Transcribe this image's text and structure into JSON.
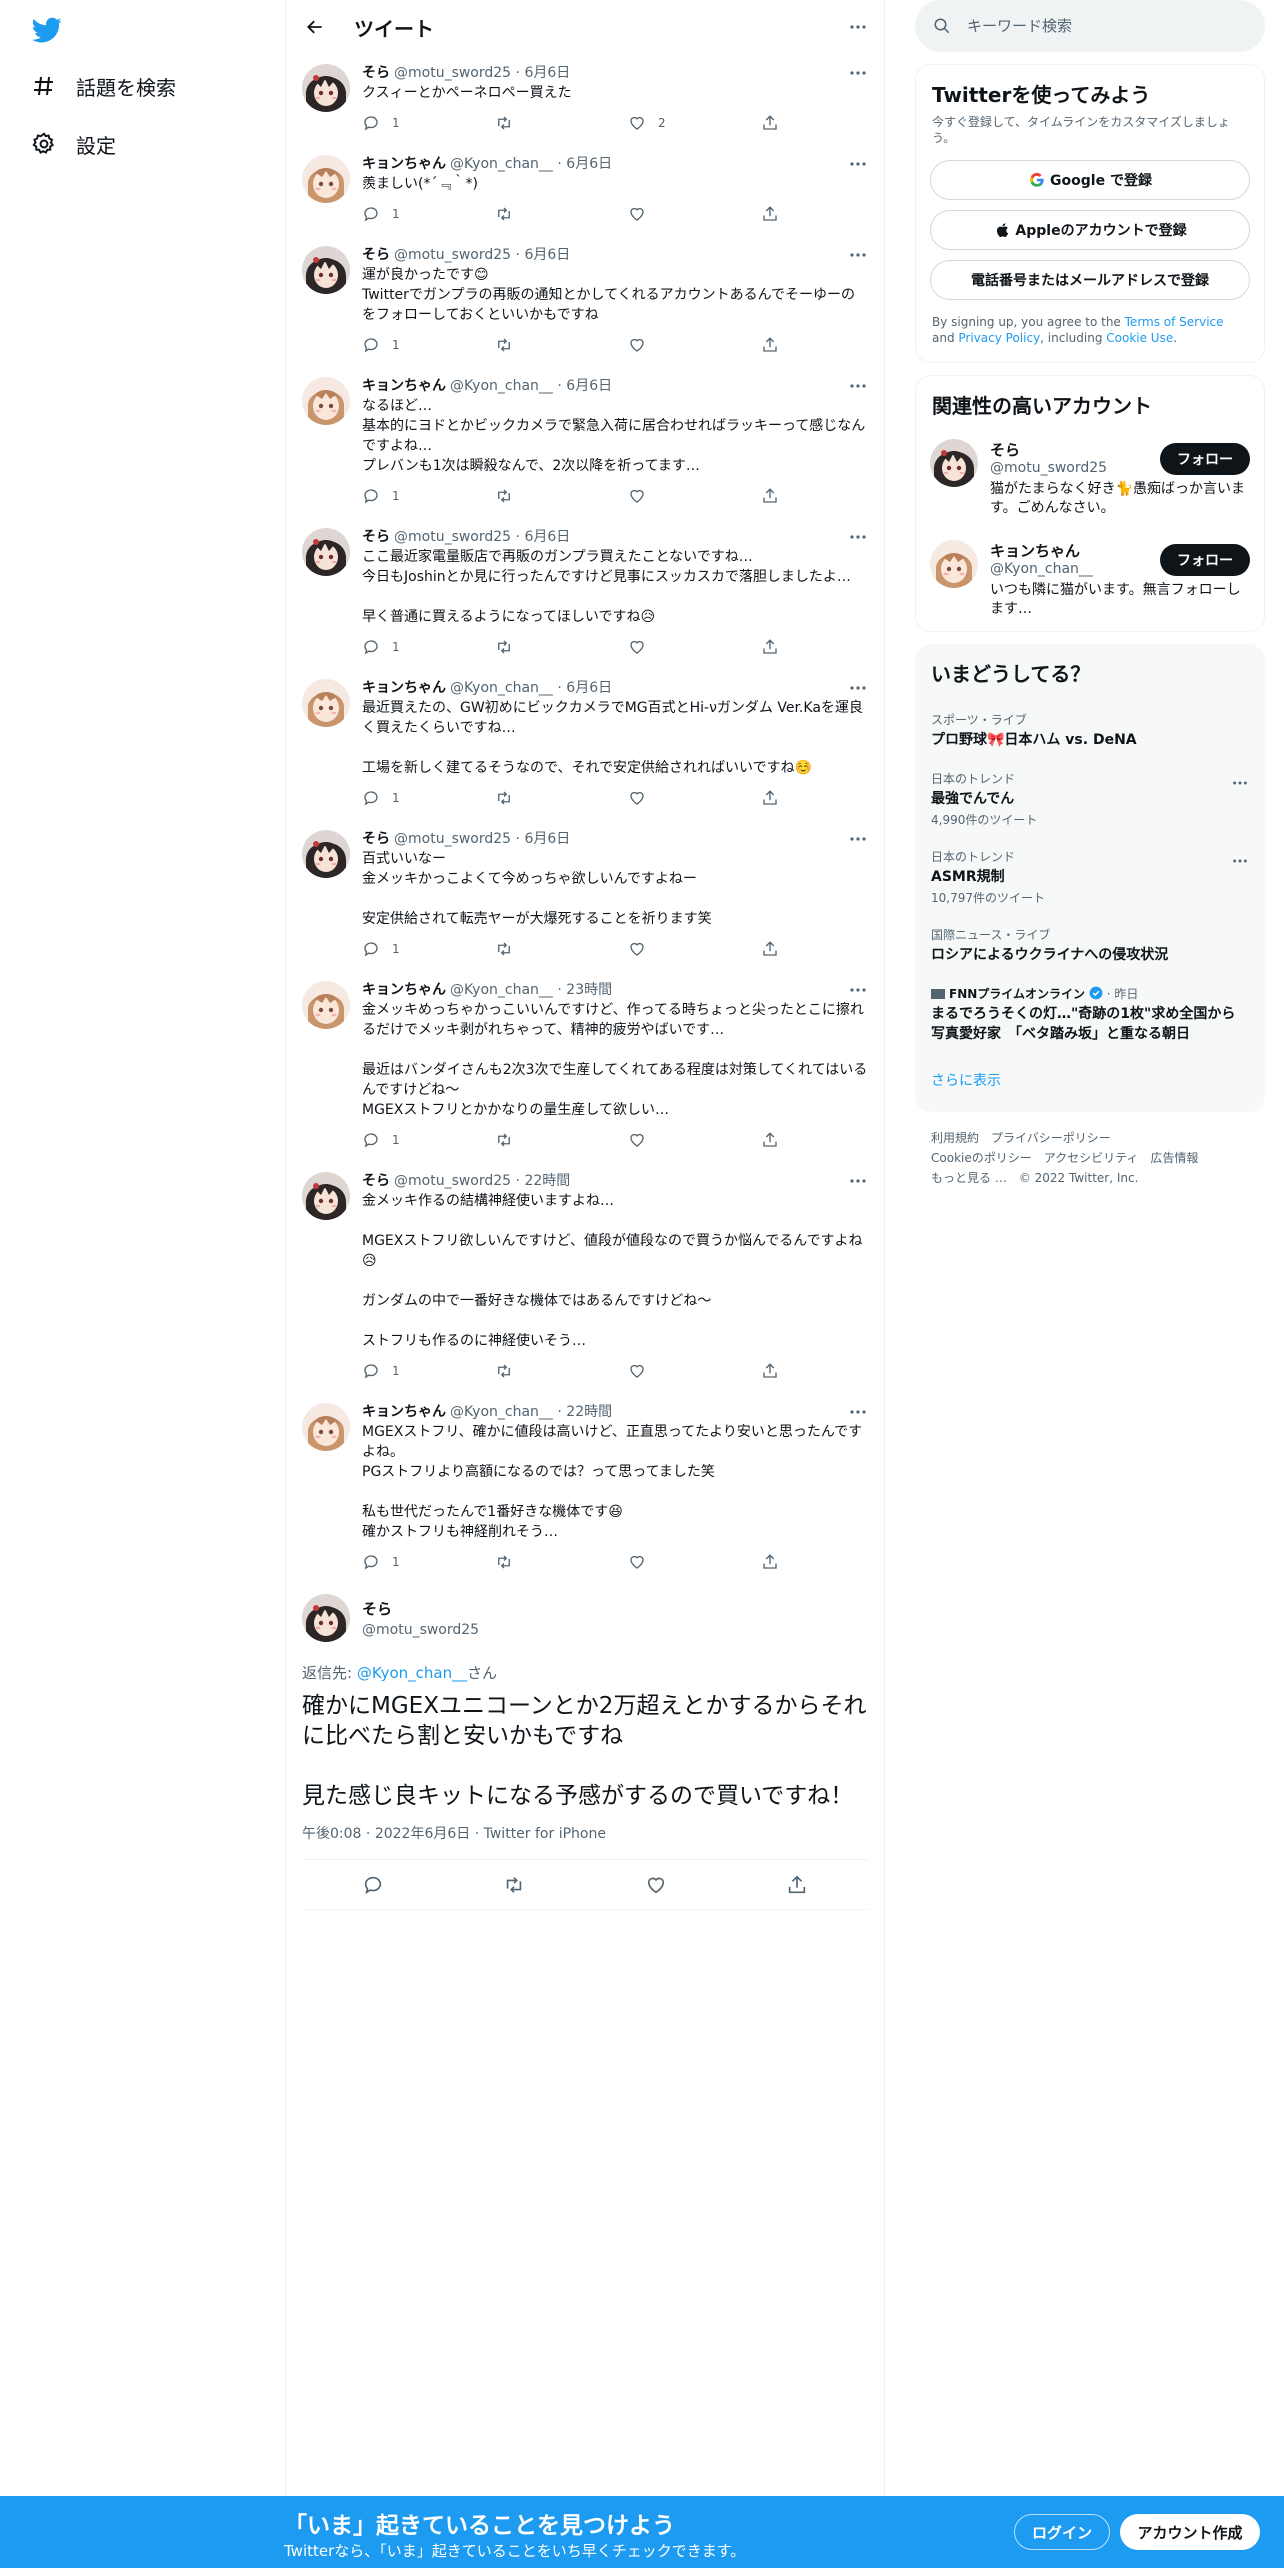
{
  "nav": {
    "explore_label": "話題を検索",
    "settings_label": "設定",
    "brand_color": "#1d9bf0"
  },
  "header": {
    "title": "ツイート"
  },
  "thread": [
    {
      "name": "そら",
      "handle": "@motu_sword25",
      "time": "6月6日",
      "text": "クスィーとかペーネロペー買えた",
      "replies": "1",
      "retweets": "",
      "likes": "2",
      "avatar": "sora"
    },
    {
      "name": "キョンちゃん",
      "handle": "@Kyon_chan__",
      "time": "6月6日",
      "text": "羨ましい(*´﹃｀*)",
      "replies": "1",
      "retweets": "",
      "likes": "",
      "avatar": "kyon"
    },
    {
      "name": "そら",
      "handle": "@motu_sword25",
      "time": "6月6日",
      "text": "運が良かったです😊\nTwitterでガンプラの再販の通知とかしてくれるアカウントあるんでそーゆーのをフォローしておくといいかもですね",
      "replies": "1",
      "retweets": "",
      "likes": "",
      "avatar": "sora"
    },
    {
      "name": "キョンちゃん",
      "handle": "@Kyon_chan__",
      "time": "6月6日",
      "text": "なるほど…\n基本的にヨドとかビックカメラで緊急入荷に居合わせればラッキーって感じなんですよね…\nプレバンも1次は瞬殺なんで、2次以降を祈ってます…",
      "replies": "1",
      "retweets": "",
      "likes": "",
      "avatar": "kyon"
    },
    {
      "name": "そら",
      "handle": "@motu_sword25",
      "time": "6月6日",
      "text": "ここ最近家電量販店で再販のガンプラ買えたことないですね…\n今日もJoshinとか見に行ったんですけど見事にスッカスカで落胆しましたよ…\n\n早く普通に買えるようになってほしいですね😥",
      "replies": "1",
      "retweets": "",
      "likes": "",
      "avatar": "sora"
    },
    {
      "name": "キョンちゃん",
      "handle": "@Kyon_chan__",
      "time": "6月6日",
      "text": "最近買えたの、GW初めにビックカメラでMG百式とHi-νガンダム Ver.Kaを運良く買えたくらいですね…\n\n工場を新しく建てるそうなので、それで安定供給されればいいですね☺️",
      "replies": "1",
      "retweets": "",
      "likes": "",
      "avatar": "kyon"
    },
    {
      "name": "そら",
      "handle": "@motu_sword25",
      "time": "6月6日",
      "text": "百式いいなー\n金メッキかっこよくて今めっちゃ欲しいんですよねー\n\n安定供給されて転売ヤーが大爆死することを祈ります笑",
      "replies": "1",
      "retweets": "",
      "likes": "",
      "avatar": "sora"
    },
    {
      "name": "キョンちゃん",
      "handle": "@Kyon_chan__",
      "time": "23時間",
      "text": "金メッキめっちゃかっこいいんですけど、作ってる時ちょっと尖ったとこに擦れるだけでメッキ剥がれちゃって、精神的疲労やばいです…\n\n最近はバンダイさんも2次3次で生産してくれてある程度は対策してくれてはいるんですけどね〜\nMGEXストフリとかかなりの量生産して欲しい…",
      "replies": "1",
      "retweets": "",
      "likes": "",
      "avatar": "kyon"
    },
    {
      "name": "そら",
      "handle": "@motu_sword25",
      "time": "22時間",
      "text": "金メッキ作るの結構神経使いますよね…\n\nMGEXストフリ欲しいんですけど、値段が値段なので買うか悩んでるんですよね😥\n\nガンダムの中で一番好きな機体ではあるんですけどね〜\n\nストフリも作るのに神経使いそう…",
      "replies": "1",
      "retweets": "",
      "likes": "",
      "avatar": "sora"
    },
    {
      "name": "キョンちゃん",
      "handle": "@Kyon_chan__",
      "time": "22時間",
      "text": "MGEXストフリ、確かに値段は高いけど、正直思ってたより安いと思ったんですよね。\nPGストフリより高額になるのでは？って思ってました笑\n\n私も世代だったんで1番好きな機体です😆\n確かストフリも神経削れそう…",
      "replies": "1",
      "retweets": "",
      "likes": "",
      "avatar": "kyon"
    }
  ],
  "focus": {
    "name": "そら",
    "handle": "@motu_sword25",
    "reply_prefix": "返信先: ",
    "reply_to": "@Kyon_chan__",
    "reply_suffix": "さん",
    "text": "確かにMGEXユニコーンとか2万超えとかするからそれに比べたら割と安いかもですね\n\n見た感じ良キットになる予感がするので買いですね！",
    "time": "午後0:08",
    "date": "2022年6月6日",
    "source": "Twitter for iPhone"
  },
  "search": {
    "placeholder": "キーワード検索"
  },
  "signup": {
    "title": "Twitterを使ってみよう",
    "subtitle": "今すぐ登録して、タイムラインをカスタマイズしましょう。",
    "google": "Google で登録",
    "apple": "Appleのアカウントで登録",
    "phone": "電話番号またはメールアドレスで登録",
    "terms_1": "By signing up, you agree to the ",
    "terms_tos": "Terms of Service",
    "terms_2": " and ",
    "terms_privacy": "Privacy Policy",
    "terms_3": ", including ",
    "terms_cookie": "Cookie Use",
    "terms_4": "."
  },
  "relevant": {
    "title": "関連性の高いアカウント",
    "accounts": [
      {
        "name": "そら",
        "handle": "@motu_sword25",
        "bio": "猫がたまらなく好き🐈愚痴ばっか言います。ごめんなさい。",
        "button": "フォロー"
      },
      {
        "name": "キョンちゃん",
        "handle": "@Kyon_chan__",
        "bio": "いつも隣に猫がいます。無言フォローします…",
        "button": "フォロー"
      }
    ]
  },
  "trends": {
    "title": "いまどうしてる？",
    "items": [
      {
        "category": "スポーツ・ライブ",
        "title": "プロ野球🎀日本ハム vs. DeNA",
        "count": ""
      },
      {
        "category": "日本のトレンド",
        "title": "最強でんでん",
        "count": "4,990件のツイート"
      },
      {
        "category": "日本のトレンド",
        "title": "ASMR規制",
        "count": "10,797件のツイート"
      },
      {
        "category": "国際ニュース・ライブ",
        "title": "ロシアによるウクライナへの侵攻状況",
        "count": ""
      }
    ],
    "news": {
      "source": "FNNプライムオンライン",
      "time": "昨日",
      "title": "まるでろうそくの灯…\"奇跡の1枚\"求め全国から写真愛好家　「ベタ踏み坂」と重なる朝日"
    },
    "show_more": "さらに表示"
  },
  "footer": {
    "links": [
      "利用規約",
      "プライバシーポリシー",
      "Cookieのポリシー",
      "アクセシビリティ",
      "広告情報",
      "もっと見る …"
    ],
    "copyright": "© 2022 Twitter, Inc."
  },
  "bottom": {
    "title": "「いま」起きていることを見つけよう",
    "subtitle": "Twitterなら、「いま」起きていることをいち早くチェックできます。",
    "login": "ログイン",
    "signup": "アカウント作成"
  }
}
